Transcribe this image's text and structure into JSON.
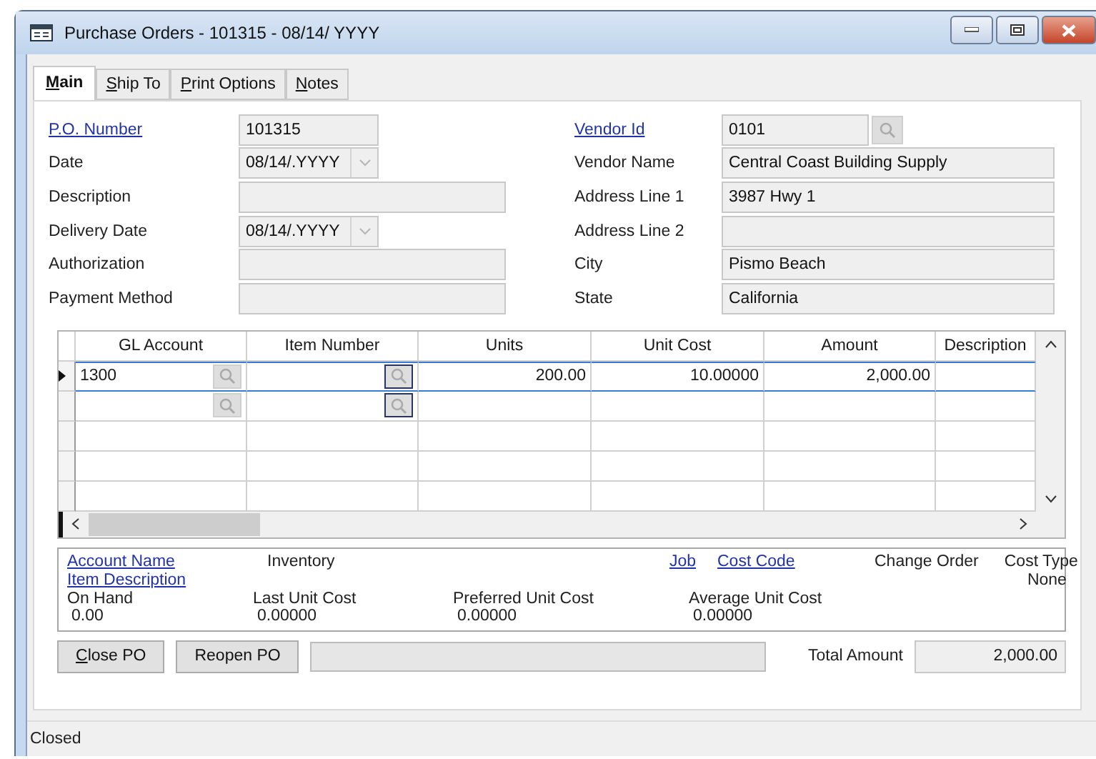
{
  "window": {
    "title": "Purchase Orders - 101315 - 08/14/ YYYY"
  },
  "tabs": [
    {
      "label": "Main",
      "selected": true,
      "underline_first": true
    },
    {
      "label": "Ship To",
      "selected": false,
      "underline_first": true
    },
    {
      "label": "Print Options",
      "selected": false,
      "underline_first": true
    },
    {
      "label": "Notes",
      "selected": false,
      "underline_first": true
    }
  ],
  "left_fields": [
    {
      "label": "P.O. Number",
      "link": true,
      "value": "101315",
      "kind": "short"
    },
    {
      "label": "Date",
      "link": false,
      "value": "08/14/.YYYY",
      "kind": "date"
    },
    {
      "label": "Description",
      "link": false,
      "kind": "wide"
    },
    {
      "label": "Delivery Date",
      "link": false,
      "value": "08/14/.YYYY",
      "kind": "date"
    },
    {
      "label": "Authorization",
      "link": false,
      "kind": "wide"
    },
    {
      "label": "Payment Method",
      "link": false,
      "kind": "wide"
    }
  ],
  "right_fields": [
    {
      "label": "Vendor Id",
      "link": true,
      "value": "0101",
      "kind": "lookup"
    },
    {
      "label": "Vendor Name",
      "link": false,
      "value": "Central Coast Building Supply",
      "kind": "wide"
    },
    {
      "label": "Address Line 1",
      "link": false,
      "value": "3987 Hwy 1",
      "kind": "wide"
    },
    {
      "label": "Address Line 2",
      "link": false,
      "kind": "wide"
    },
    {
      "label": "City",
      "link": false,
      "value": "Pismo Beach",
      "kind": "wide"
    },
    {
      "label": "State",
      "link": false,
      "value": "California",
      "kind": "wide"
    }
  ],
  "grid": {
    "columns": [
      "GL Account",
      "Item Number",
      "Units",
      "Unit Cost",
      "Amount",
      "Description"
    ],
    "rows": [
      {
        "selected": true,
        "lookup": true,
        "gl_account": "1300",
        "units": "200.00",
        "unit_cost": "10.00000",
        "amount": "2,000.00"
      },
      {
        "selected": false,
        "lookup": true
      },
      {
        "selected": false,
        "lookup": false
      },
      {
        "selected": false,
        "lookup": false
      },
      {
        "selected": false,
        "lookup": false
      }
    ]
  },
  "details": {
    "account_name": {
      "label": "Account Name",
      "value": "Inventory"
    },
    "item_description": {
      "label": "Item Description"
    },
    "job": {
      "label": "Job"
    },
    "cost_code": {
      "label": "Cost Code"
    },
    "change_order": {
      "label": "Change Order"
    },
    "cost_type": {
      "label": "Cost Type",
      "value": "None"
    },
    "stats": [
      {
        "label": "On Hand",
        "value": "0.00"
      },
      {
        "label": "Last Unit Cost",
        "value": "0.00000"
      },
      {
        "label": "Preferred Unit Cost",
        "value": "0.00000"
      },
      {
        "label": "Average Unit Cost",
        "value": "0.00000"
      }
    ]
  },
  "buttons": [
    {
      "label": "Close PO",
      "underline_first": true
    },
    {
      "label": "Reopen PO",
      "underline_first": false
    }
  ],
  "total": {
    "label": "Total Amount",
    "value": "2,000.00"
  },
  "status_bar": "Closed"
}
